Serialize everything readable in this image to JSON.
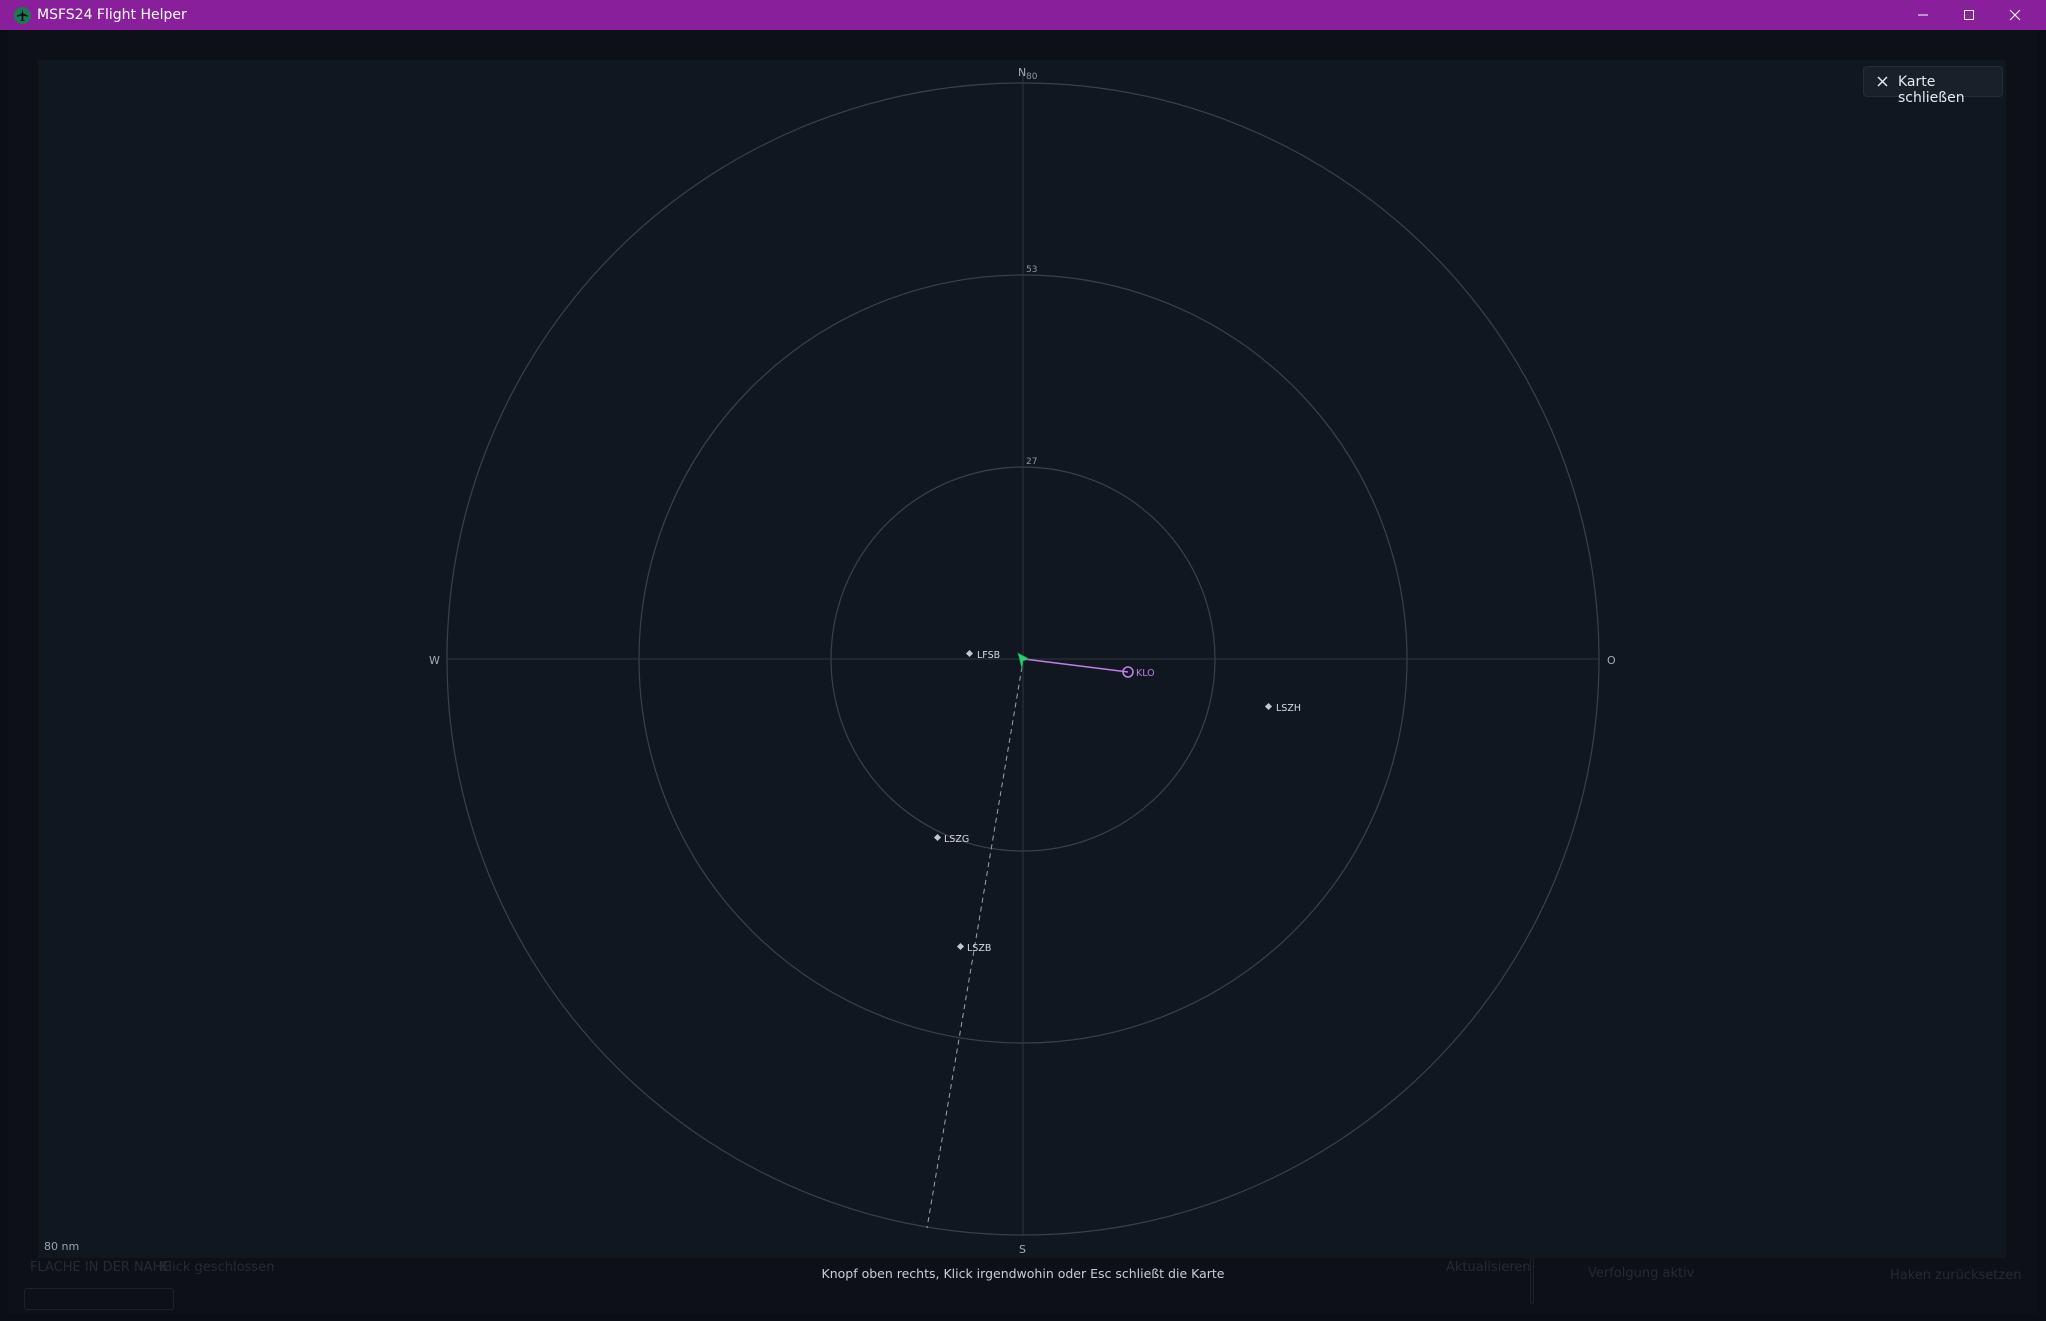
{
  "window": {
    "title": "MSFS24 Flight Helper",
    "title_bar_color": "#8a1f9c"
  },
  "map": {
    "close_button_label": "Karte schließen",
    "scale_label": "80 nm",
    "hint": "Knopf oben rechts, Klick irgendwohin oder Esc schließt die Karte",
    "compass": {
      "north": "N",
      "south": "S",
      "west": "W",
      "east": "O"
    },
    "ring_labels": [
      "27",
      "53",
      "80"
    ],
    "airports": [
      {
        "id": "LFSB"
      },
      {
        "id": "LSZH"
      },
      {
        "id": "LSZG"
      },
      {
        "id": "LSZB"
      }
    ],
    "waypoint": {
      "id": "KLO",
      "color": "#c07ee6"
    },
    "aircraft_color": "#2ecc71",
    "ring_color": "#39414d"
  },
  "background": {
    "section_title": "FLACHE IN DER NAHE",
    "section_note": "Klick geschlossen",
    "refresh_label": "Aktualisieren",
    "checkbox_label": "Verfolgung aktiv",
    "reset_label": "Haken zurücksetzen"
  }
}
